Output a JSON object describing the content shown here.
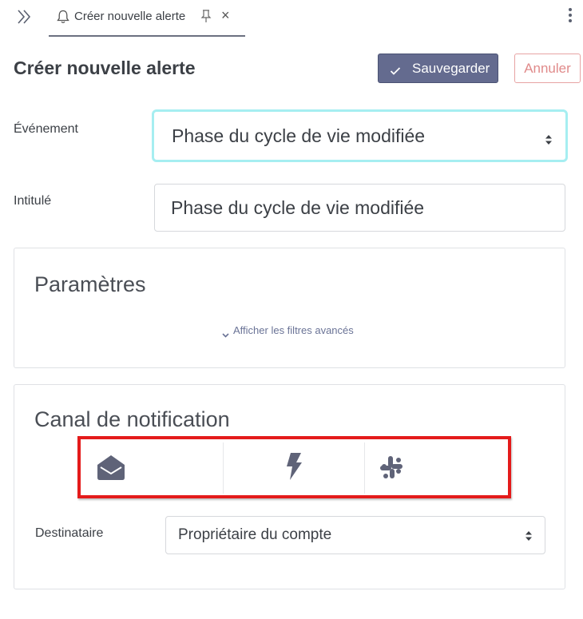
{
  "tab": {
    "label": "Créer nouvelle alerte",
    "close_glyph": "×"
  },
  "header": {
    "title": "Créer nouvelle alerte",
    "save_label": "Sauvegarder",
    "cancel_label": "Annuler"
  },
  "form": {
    "event_label": "Événement",
    "event_value": "Phase du cycle de vie modifiée",
    "title_label": "Intitulé",
    "title_value": "Phase du cycle de vie modifiée"
  },
  "params": {
    "title": "Paramètres",
    "advanced_link": "Afficher les filtres avancés"
  },
  "notification": {
    "title": "Canal de notification",
    "channels": [
      "envelope-icon",
      "lightning-icon",
      "slack-icon"
    ],
    "recipient_label": "Destinataire",
    "recipient_value": "Propriétaire du compte"
  },
  "icons": [
    "double-chevron-right-icon",
    "bell-icon",
    "pin-icon",
    "close-icon",
    "kebab-menu-icon",
    "check-icon",
    "select-caret-icon",
    "chevron-down-icon"
  ],
  "colors": {
    "primary": "#646b8f",
    "cancel": "#e08a8a",
    "focus_border": "#a6eef1",
    "highlight": "#e41b1b",
    "icon": "#5f6378"
  }
}
